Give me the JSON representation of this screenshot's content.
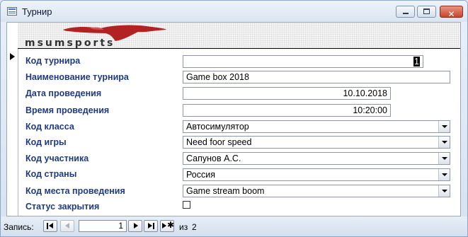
{
  "window": {
    "title": "Турнир",
    "close_glyph": "✕"
  },
  "header": {
    "logo_text": "msumsports"
  },
  "form": {
    "fields": [
      {
        "label": "Код турнира",
        "value": "1"
      },
      {
        "label": "Наименование турнира",
        "value": "Game box 2018"
      },
      {
        "label": "Дата проведения",
        "value": "10.10.2018"
      },
      {
        "label": "Время проведения",
        "value": "10:20:00"
      },
      {
        "label": "Код класса",
        "value": "Автосимулятор"
      },
      {
        "label": "Код игры",
        "value": "Need foor speed"
      },
      {
        "label": "Код участника",
        "value": "Сапунов А.С."
      },
      {
        "label": "Код страны",
        "value": "Россия"
      },
      {
        "label": "Код места проведения",
        "value": "Game stream boom"
      },
      {
        "label": "Статус закрытия",
        "checked": false
      }
    ]
  },
  "navigator": {
    "label": "Запись:",
    "current": "1",
    "of_label": "из",
    "total": "2",
    "new_record_glyph": "✱"
  },
  "icons": [
    "form-icon",
    "minimize-icon",
    "maximize-icon",
    "close-icon",
    "record-selector-arrow-icon",
    "first-record-icon",
    "previous-record-icon",
    "next-record-icon",
    "last-record-icon",
    "new-record-icon",
    "dropdown-arrow-icon"
  ],
  "colors": {
    "label": "#1f3a82",
    "logo_splash": "#b22222",
    "close_button": "#c8452c"
  }
}
